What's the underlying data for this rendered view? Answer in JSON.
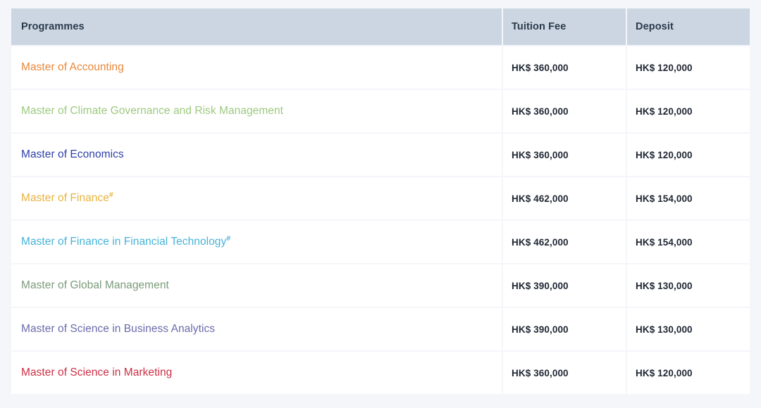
{
  "table": {
    "columns": [
      "Programmes",
      "Tuition Fee",
      "Deposit"
    ],
    "header": {
      "programmes": "Programmes",
      "tuition_fee": "Tuition Fee",
      "deposit": "Deposit"
    },
    "header_background": "#ccd6e3",
    "page_background": "#f4f6fa",
    "rows": [
      {
        "programme": "Master of Accounting",
        "marker": "",
        "color": "#e8883a",
        "tuition_fee": "HK$ 360,000",
        "deposit": "HK$ 120,000"
      },
      {
        "programme": "Master of Climate Governance and Risk Management",
        "marker": "",
        "color": "#9dc97f",
        "tuition_fee": "HK$ 360,000",
        "deposit": "HK$ 120,000"
      },
      {
        "programme": "Master of Economics",
        "marker": "",
        "color": "#2d3fa8",
        "tuition_fee": "HK$ 360,000",
        "deposit": "HK$ 120,000"
      },
      {
        "programme": "Master of Finance",
        "marker": "#",
        "color": "#e8b33c",
        "tuition_fee": "HK$ 462,000",
        "deposit": "HK$ 154,000"
      },
      {
        "programme": "Master of Finance in Financial Technology",
        "marker": "#",
        "color": "#45b3d8",
        "tuition_fee": "HK$ 462,000",
        "deposit": "HK$ 154,000"
      },
      {
        "programme": "Master of Global Management",
        "marker": "",
        "color": "#7a9b7a",
        "tuition_fee": "HK$ 390,000",
        "deposit": "HK$ 130,000"
      },
      {
        "programme": "Master of Science in Business Analytics",
        "marker": "",
        "color": "#6c6bab",
        "tuition_fee": "HK$ 390,000",
        "deposit": "HK$ 130,000"
      },
      {
        "programme": "Master of Science in Marketing",
        "marker": "",
        "color": "#cc2e44",
        "tuition_fee": "HK$ 360,000",
        "deposit": "HK$ 120,000"
      }
    ]
  }
}
